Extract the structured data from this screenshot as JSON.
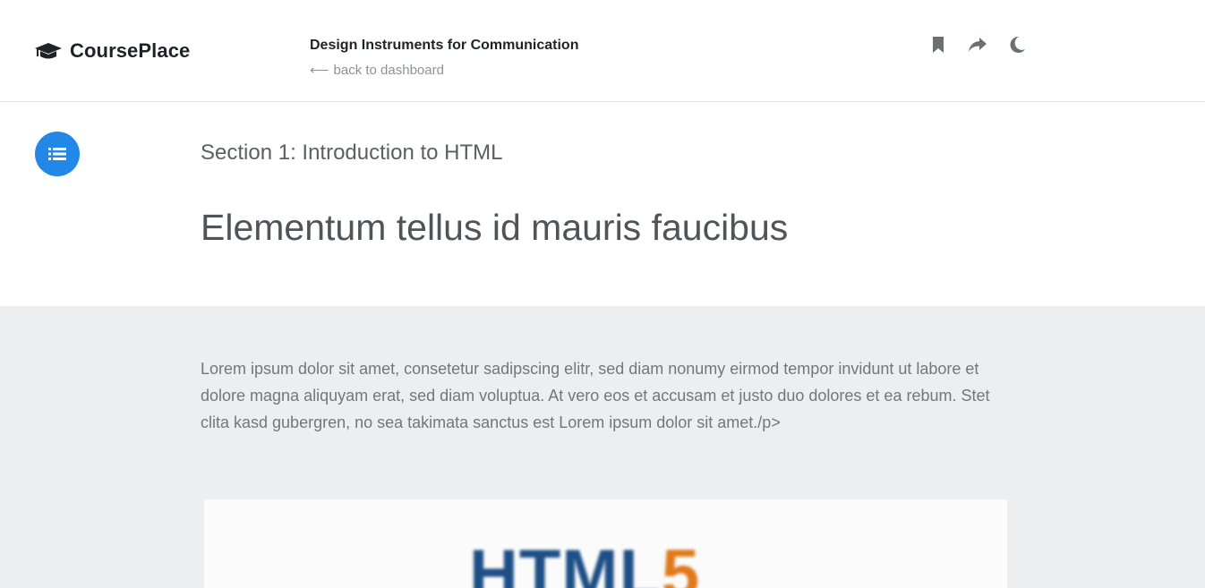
{
  "header": {
    "brand": "CoursePlace",
    "course_title": "Design Instruments for Communication",
    "back_label": "back to dashboard",
    "actions": [
      {
        "name": "bookmark-icon"
      },
      {
        "name": "share-icon"
      },
      {
        "name": "moon-icon"
      }
    ]
  },
  "lesson": {
    "section_label": "Section 1: Introduction to HTML",
    "title": "Elementum tellus id mauris faucibus",
    "paragraph": "Lorem ipsum dolor sit amet, consetetur sadipscing elitr, sed diam nonumy eirmod tempor invidunt ut labore et dolore magna aliquyam erat, sed diam voluptua. At vero eos et accusam et justo duo dolores et ea rebum. Stet clita kasd gubergren, no sea takimata sanctus est Lorem ipsum dolor sit amet./p>",
    "figure": {
      "logo_text": "HTML",
      "logo_number": "5"
    }
  },
  "colors": {
    "accent": "#2188e8",
    "body_bg": "#edeef0",
    "icon_gray": "#6b7075"
  }
}
